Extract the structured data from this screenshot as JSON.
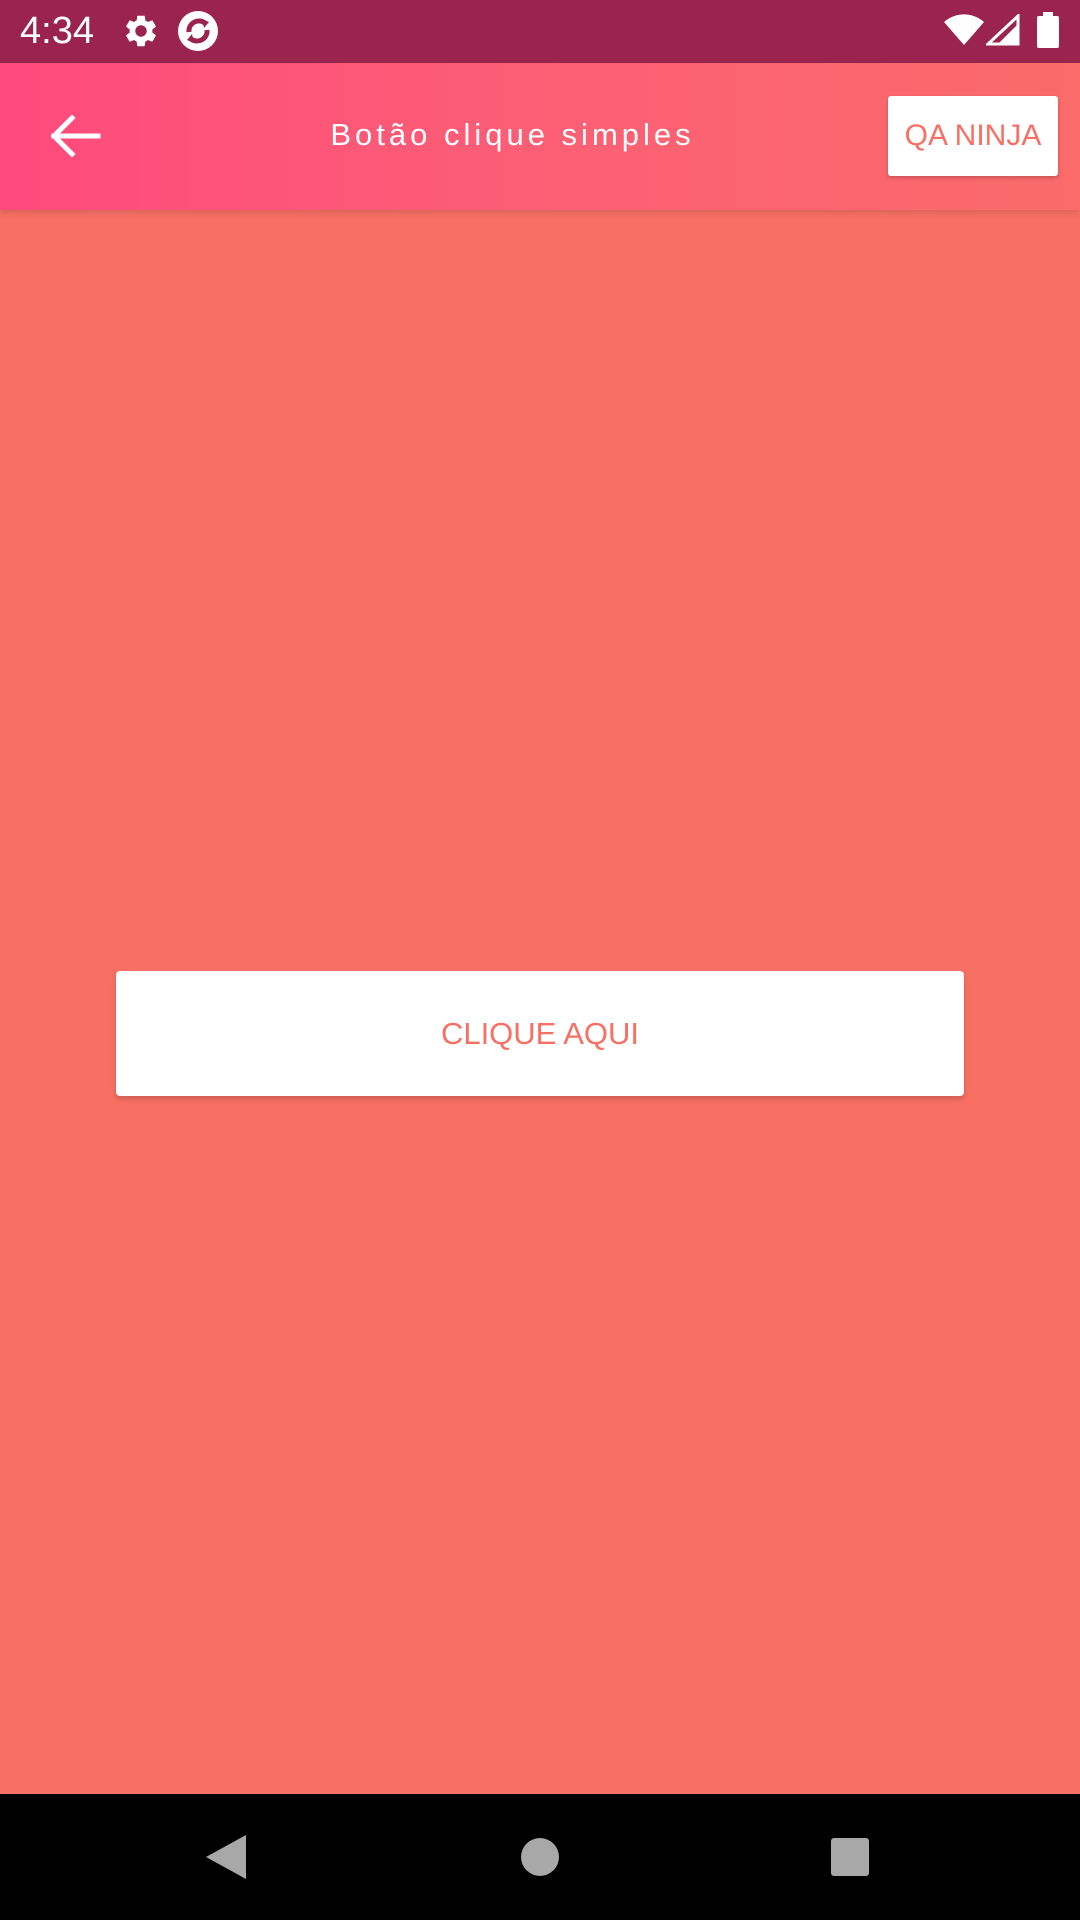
{
  "status_bar": {
    "time": "4:34",
    "icons": [
      "gear-icon",
      "sync-app-icon",
      "wifi-icon",
      "signal-icon",
      "battery-icon"
    ],
    "background": "#9a244d"
  },
  "toolbar": {
    "back_icon": "arrow-back-icon",
    "title": "Botão clique simples",
    "action_label": "QA NINJA",
    "gradient": [
      "#fe4a7d",
      "#fa6b6a"
    ]
  },
  "main": {
    "background": "#f87064",
    "button_label": "CLIQUE AQUI"
  },
  "nav_bar": {
    "buttons": [
      "back-triangle-icon",
      "home-circle-icon",
      "recents-square-icon"
    ]
  }
}
